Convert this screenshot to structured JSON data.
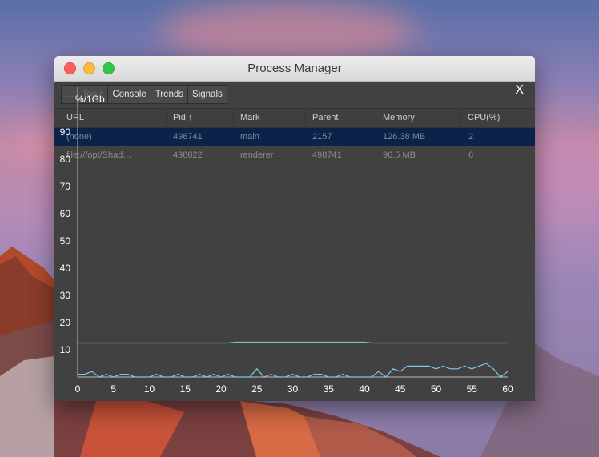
{
  "window": {
    "title": "Process Manager",
    "close_label": "X"
  },
  "toolbar": {
    "tabs": [
      {
        "label": "...",
        "dim": true
      },
      {
        "label": "Tools",
        "dim": true
      },
      {
        "label": "Console",
        "dim": false
      },
      {
        "label": "Trends",
        "dim": false
      },
      {
        "label": "Signals",
        "dim": false
      }
    ]
  },
  "table": {
    "columns": [
      "URL",
      "Pid ↑",
      "Mark",
      "Parent",
      "Memory",
      "CPU(%)"
    ],
    "rows": [
      {
        "url": "(none)",
        "pid": "498741",
        "mark": "main",
        "parent": "2157",
        "memory": "126.38 MB",
        "cpu": "2",
        "selected": true
      },
      {
        "url": "file:///opt/Shad…",
        "pid": "498822",
        "mark": "renderer",
        "parent": "498741",
        "memory": "96.5 MB",
        "cpu": "6",
        "selected": false
      }
    ]
  },
  "chart_data": {
    "type": "line",
    "ylabel": "%/1Gb",
    "xlim": [
      0,
      60
    ],
    "ylim": [
      0,
      90
    ],
    "x_ticks": [
      0,
      5,
      10,
      15,
      20,
      25,
      30,
      35,
      40,
      45,
      50,
      55,
      60
    ],
    "y_ticks": [
      10,
      20,
      30,
      40,
      50,
      60,
      70,
      80,
      90
    ],
    "grid": false,
    "series": [
      {
        "color": "#6fd1a0",
        "x": [
          0,
          5,
          10,
          15,
          20,
          21,
          22,
          25,
          30,
          35,
          40,
          41,
          42,
          45,
          50,
          55,
          60
        ],
        "y": [
          12.5,
          12.5,
          12.5,
          12.5,
          12.5,
          12.5,
          12.8,
          12.8,
          12.8,
          12.8,
          12.8,
          12.5,
          12.5,
          12.5,
          12.5,
          12.5,
          12.5
        ]
      },
      {
        "color": "#79c9ea",
        "x": [
          0,
          1,
          2,
          3,
          4,
          5,
          6,
          7,
          8,
          9,
          10,
          11,
          12,
          13,
          14,
          15,
          16,
          17,
          18,
          19,
          20,
          21,
          22,
          23,
          24,
          25,
          26,
          27,
          28,
          29,
          30,
          31,
          32,
          33,
          34,
          35,
          36,
          37,
          38,
          39,
          40,
          41,
          42,
          43,
          44,
          45,
          46,
          47,
          48,
          49,
          50,
          51,
          52,
          53,
          54,
          55,
          56,
          57,
          58,
          59,
          60
        ],
        "y": [
          1,
          1,
          2,
          0,
          1,
          0,
          1,
          1,
          0,
          0,
          0,
          1,
          0,
          0,
          1,
          0,
          0,
          1,
          0,
          1,
          0,
          1,
          0,
          0,
          0,
          3,
          0,
          1,
          0,
          0,
          1,
          0,
          0,
          1,
          1,
          0,
          0,
          1,
          0,
          0,
          0,
          0,
          2,
          0,
          3,
          2,
          4,
          4,
          4,
          4,
          3,
          4,
          3,
          3,
          4,
          3,
          4,
          5,
          3,
          0,
          2
        ]
      }
    ]
  }
}
